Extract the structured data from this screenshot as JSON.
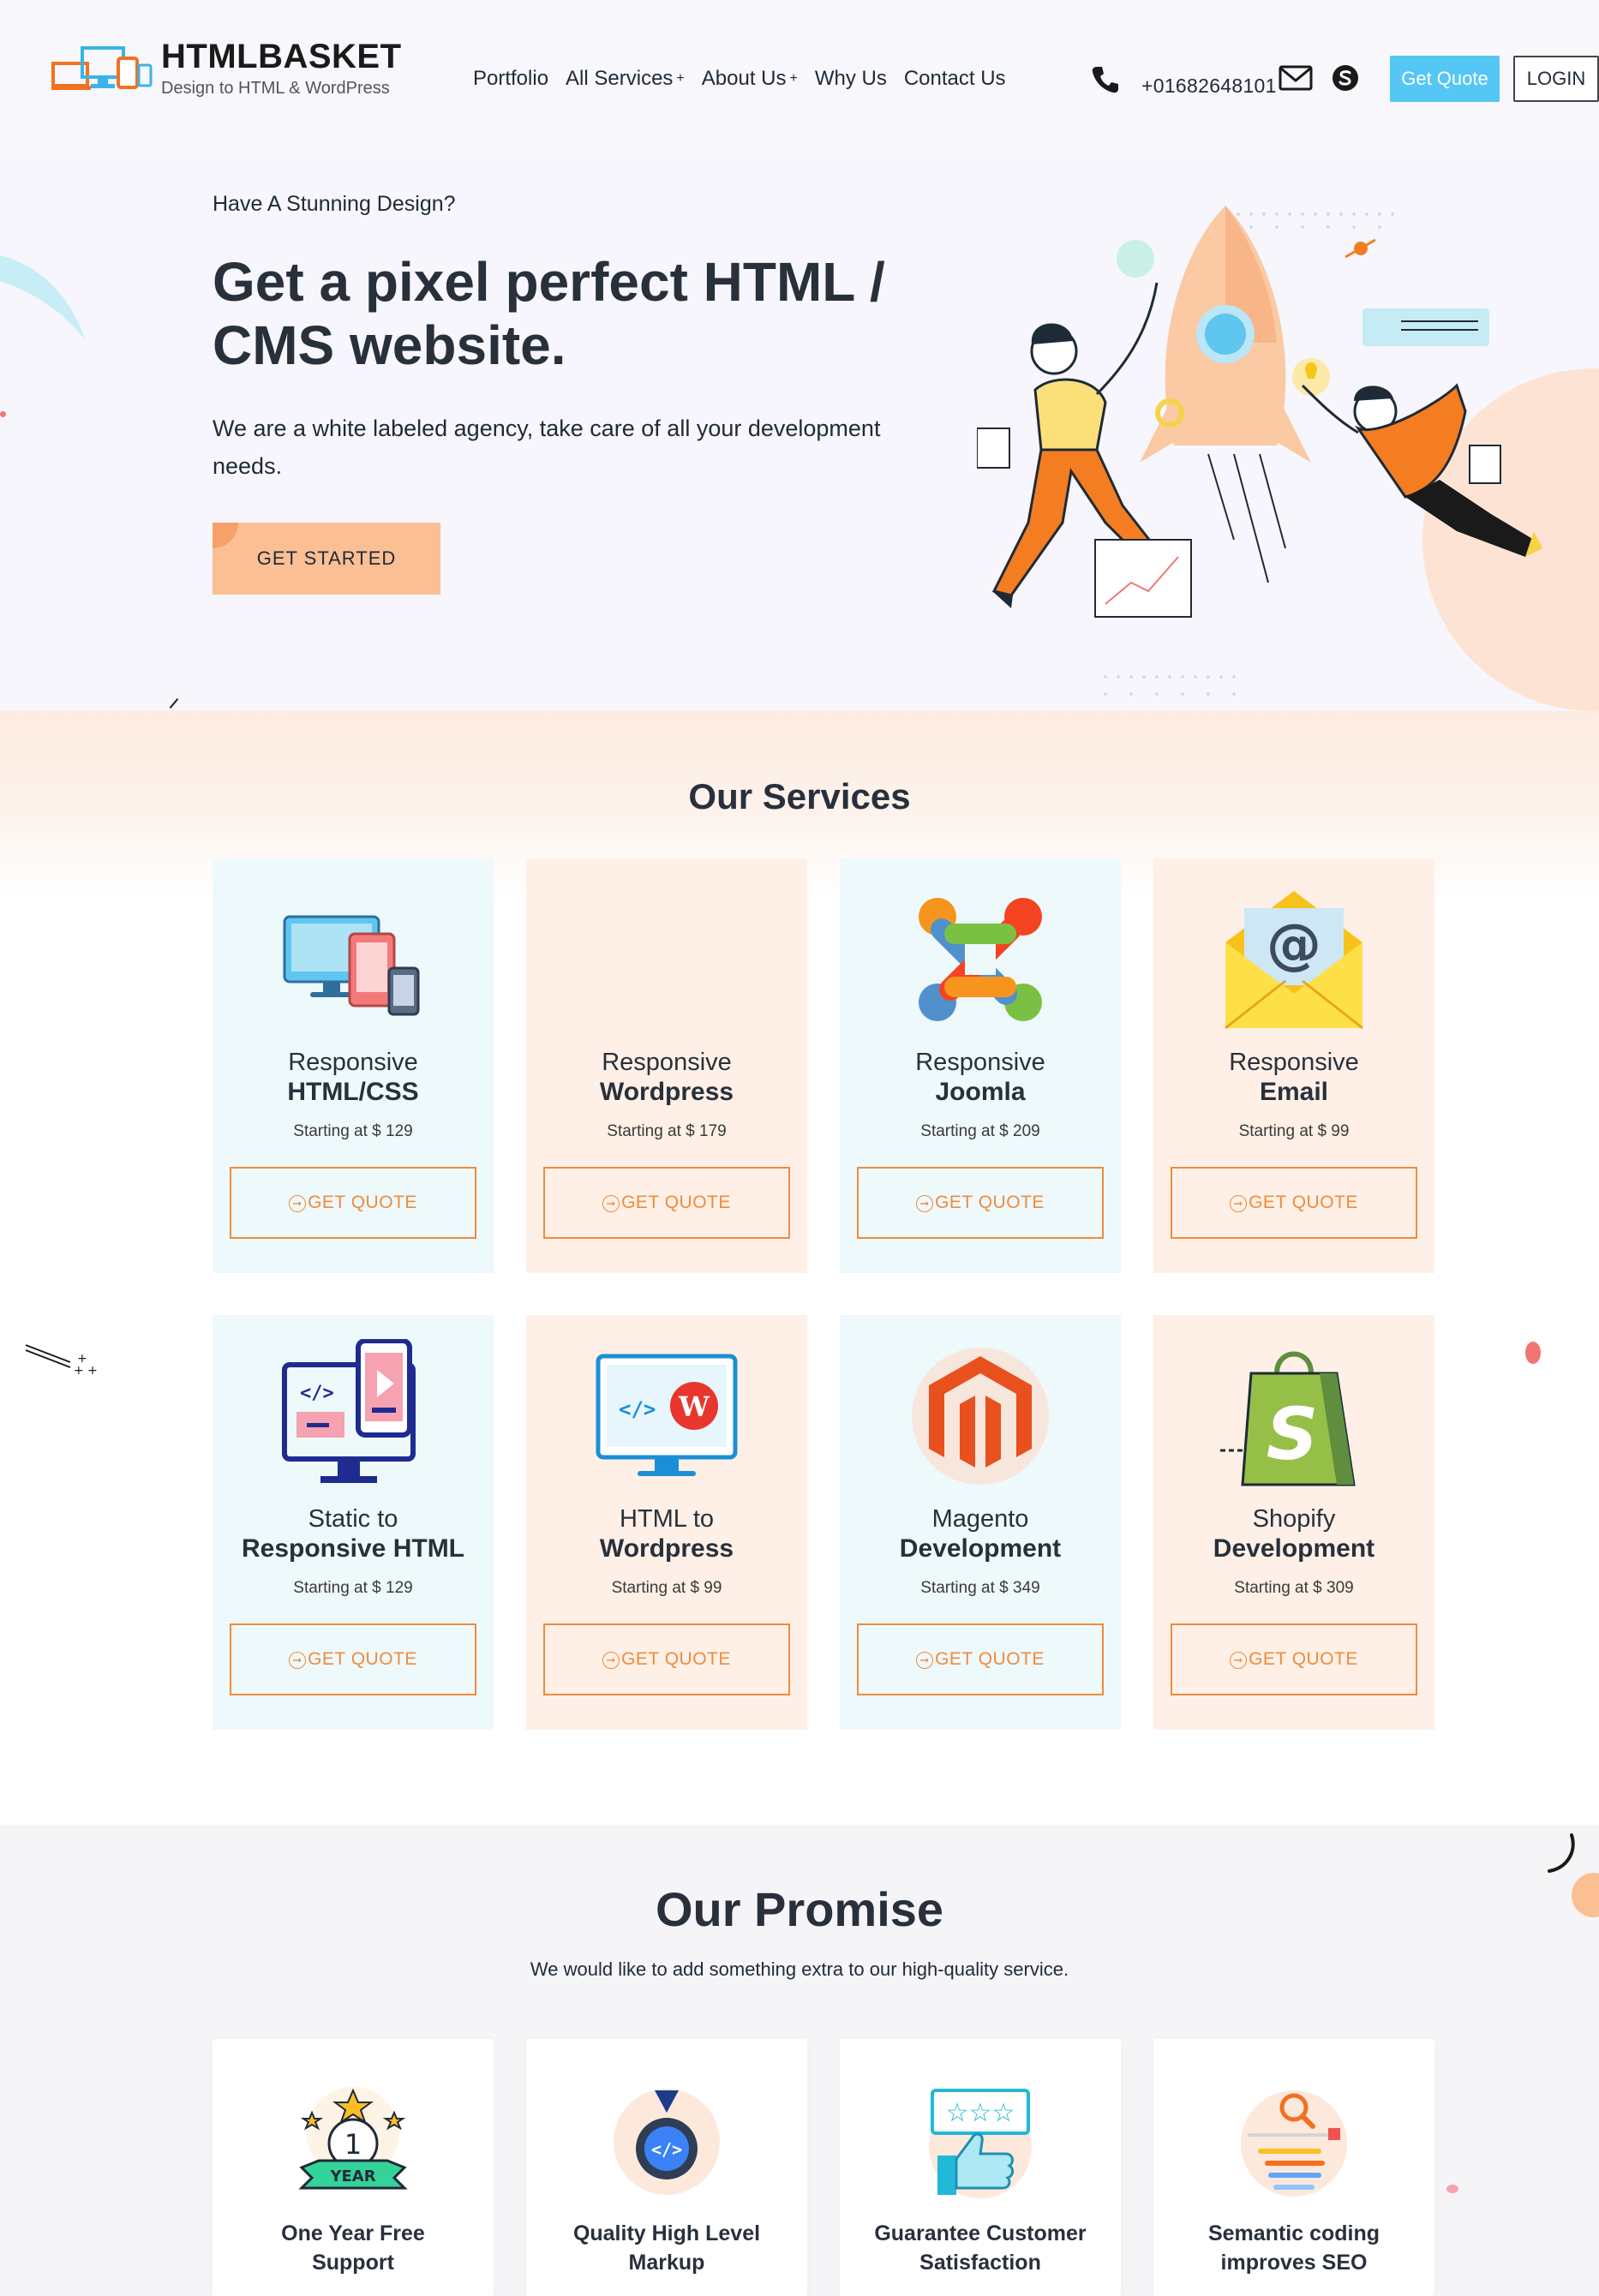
{
  "header": {
    "logo_name": "HTMLBASKET",
    "logo_tagline": "Design to HTML & WordPress",
    "nav": [
      {
        "label": "Portfolio",
        "has_plus": false
      },
      {
        "label": "All Services",
        "has_plus": true
      },
      {
        "label": "About Us",
        "has_plus": true
      },
      {
        "label": "Why Us",
        "has_plus": false
      },
      {
        "label": "Contact Us",
        "has_plus": false
      }
    ],
    "plus_glyph": "+",
    "phone": "+01682648101",
    "quote_label": "Get Quote",
    "login_label": "LOGIN"
  },
  "hero": {
    "eyebrow": "Have A Stunning Design?",
    "title": "Get a pixel perfect HTML / CMS website.",
    "text": "We are a white labeled agency, take care of all your development needs.",
    "cta": "GET STARTED"
  },
  "services": {
    "title": "Our Services",
    "quote_label": "GET QUOTE",
    "items": [
      {
        "line1": "Responsive",
        "line2": "HTML/CSS",
        "price": "Starting at $ 129",
        "icon": "devices-icon"
      },
      {
        "line1": "Responsive",
        "line2": "Wordpress",
        "price": "Starting at $ 179",
        "icon": "wordpress-placeholder"
      },
      {
        "line1": "Responsive",
        "line2": "Joomla",
        "price": "Starting at $ 209",
        "icon": "joomla-icon"
      },
      {
        "line1": "Responsive",
        "line2": "Email",
        "price": "Starting at $ 99",
        "icon": "email-icon"
      },
      {
        "line1": "Static to",
        "line2": "Responsive HTML",
        "price": "Starting at $ 129",
        "icon": "static-to-responsive-icon"
      },
      {
        "line1": "HTML to",
        "line2": "Wordpress",
        "price": "Starting at $ 99",
        "icon": "html-to-wordpress-icon"
      },
      {
        "line1": "Magento",
        "line2": "Development",
        "price": "Starting at $ 349",
        "icon": "magento-icon"
      },
      {
        "line1": "Shopify",
        "line2": "Development",
        "price": "Starting at $ 309",
        "icon": "shopify-icon"
      }
    ]
  },
  "promise": {
    "title": "Our Promise",
    "subtitle": "We would like to add something extra to our high-quality service.",
    "items": [
      {
        "line1": "One Year Free",
        "line2": "Support",
        "icon": "one-year-badge-icon"
      },
      {
        "line1": "Quality High Level",
        "line2": "Markup",
        "icon": "quality-medal-icon"
      },
      {
        "line1": "Guarantee Customer",
        "line2": "Satisfaction",
        "icon": "thumbs-up-rating-icon"
      },
      {
        "line1": "Semantic coding",
        "line2": "improves SEO",
        "icon": "seo-search-icon"
      }
    ],
    "badge_number": "1",
    "badge_text": "YEAR"
  },
  "colors": {
    "accent_orange": "#f08a3c",
    "quote_blue": "#55c7f5",
    "card_blue": "#eef9fb",
    "card_peach": "#fef0e6"
  }
}
